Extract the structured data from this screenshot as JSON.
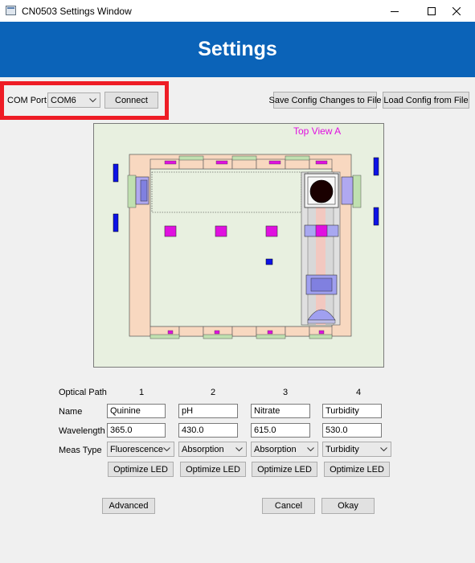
{
  "window": {
    "title": "CN0503 Settings Window",
    "icon": "app-window-icon",
    "controls": [
      "minimize-icon",
      "maximize-icon",
      "close-icon"
    ]
  },
  "banner": {
    "title": "Settings"
  },
  "connection": {
    "com_port_label": "COM Port",
    "com_port_value": "COM6",
    "connect_label": "Connect",
    "highlight_color": "#ee1c25"
  },
  "config": {
    "save_label": "Save Config Changes to File",
    "load_label": "Load Config from File"
  },
  "diagram": {
    "view_label": "Top View A",
    "label_color": "#e010e0"
  },
  "optical": {
    "header_label": "Optical Path",
    "paths": [
      "1",
      "2",
      "3",
      "4"
    ],
    "name_label": "Name",
    "names": [
      "Quinine",
      "pH",
      "Nitrate",
      "Turbidity"
    ],
    "wavelength_label": "Wavelength",
    "wavelengths": [
      "365.0",
      "430.0",
      "615.0",
      "530.0"
    ],
    "meas_type_label": "Meas Type",
    "meas_types": [
      "Fluorescence",
      "Absorption",
      "Absorption",
      "Turbidity"
    ],
    "optimize_label": "Optimize LED"
  },
  "footer": {
    "advanced_label": "Advanced",
    "cancel_label": "Cancel",
    "okay_label": "Okay"
  },
  "colors": {
    "banner": "#0b63b8",
    "background": "#f0f0f0"
  }
}
